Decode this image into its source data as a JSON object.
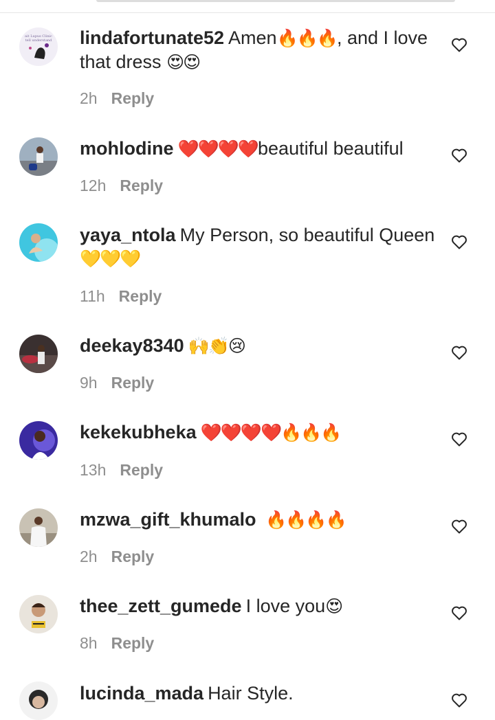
{
  "comments": [
    {
      "username": "lindafortunate52",
      "text": "Amen",
      "emoji": "🔥🔥🔥",
      "text2": ", and I love that dress",
      "emoji2": "😍😍",
      "time": "2h",
      "reply": "Reply"
    },
    {
      "username": "mohlodine",
      "text": "",
      "emoji": "❤️❤️❤️❤️",
      "text2": "beautiful beautiful",
      "emoji2": "",
      "time": "12h",
      "reply": "Reply"
    },
    {
      "username": "yaya_ntola",
      "text": "My Person, so beautiful Queen",
      "emoji": "💛💛💛",
      "text2": "",
      "emoji2": "",
      "time": "11h",
      "reply": "Reply"
    },
    {
      "username": "deekay8340",
      "text": "",
      "emoji": "🙌👏😢",
      "text2": "",
      "emoji2": "",
      "time": "9h",
      "reply": "Reply"
    },
    {
      "username": "kekekubheka",
      "text": "",
      "emoji": "❤️❤️❤️❤️🔥🔥🔥",
      "text2": "",
      "emoji2": "",
      "time": "13h",
      "reply": "Reply"
    },
    {
      "username": "mzwa_gift_khumalo",
      "text": "",
      "emoji": "🔥🔥🔥🔥",
      "text2": "",
      "emoji2": "",
      "time": "2h",
      "reply": "Reply"
    },
    {
      "username": "thee_zett_gumede",
      "text": "I love you",
      "emoji": "😍",
      "text2": "",
      "emoji2": "",
      "time": "8h",
      "reply": "Reply"
    },
    {
      "username": "lucinda_mada",
      "text": "Hair Style.",
      "emoji": "",
      "text2": "",
      "emoji2": "",
      "time": "",
      "reply": ""
    }
  ],
  "colors": {
    "text": "#262626",
    "meta": "#8e8e8e",
    "divider": "#e6e6e6"
  },
  "icons": {
    "like": "heart-outline-icon"
  }
}
